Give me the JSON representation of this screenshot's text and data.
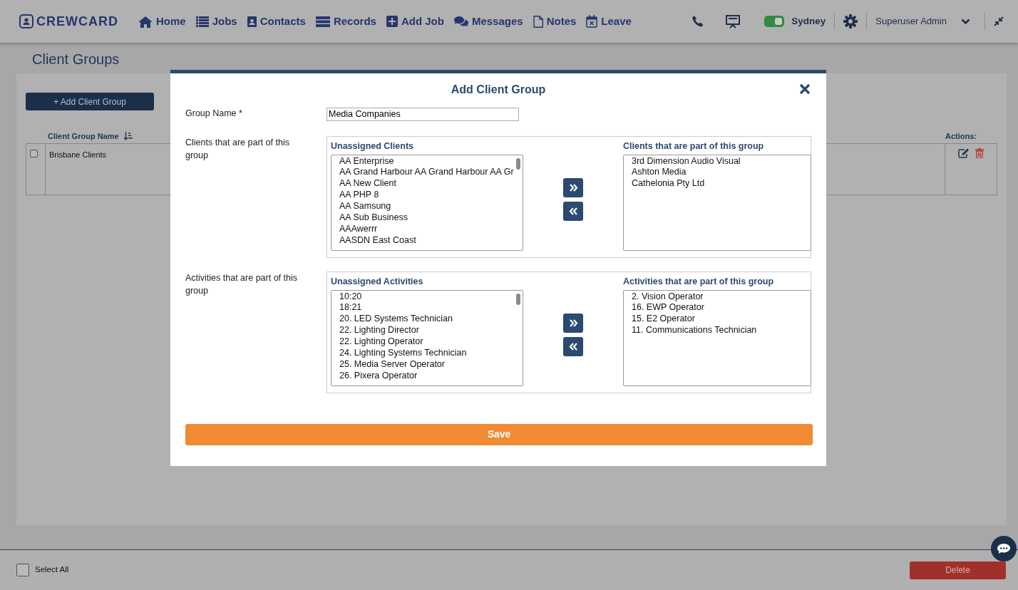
{
  "navbar": {
    "logo": "CREWCARD",
    "items": [
      {
        "label": "Home",
        "kind": "home"
      },
      {
        "label": "Jobs",
        "kind": "list"
      },
      {
        "label": "Contacts",
        "kind": "contacts"
      },
      {
        "label": "Records",
        "kind": "records"
      },
      {
        "label": "Add Job",
        "kind": "add"
      },
      {
        "label": "Messages",
        "kind": "messages"
      },
      {
        "label": "Notes",
        "kind": "notes"
      },
      {
        "label": "Leave",
        "kind": "leave"
      }
    ],
    "location": {
      "label": "Sydney",
      "on": true
    },
    "user": "Superuser Admin"
  },
  "page": {
    "title": "Client Groups",
    "add_button": "+ Add Client Group",
    "columns": [
      "Client Group Name",
      "Actions:"
    ],
    "rows": [
      {
        "name": "Brisbane Clients",
        "checked": false
      }
    ]
  },
  "footer": {
    "select_all": {
      "label": "Select All",
      "checked": false
    },
    "delete_button": "Delete"
  },
  "modal": {
    "title": "Add Client Group",
    "group_name": {
      "label": "Group Name *",
      "value": "Media Companies"
    },
    "sections": [
      {
        "label": "Clients that are part of this group",
        "left_title": "Unassigned Clients",
        "right_title": "Clients that are part of this group",
        "left_items": [
          "AA Enterprise",
          "AA Grand Harbour AA Grand Harbour AA Gr",
          "AA New Client",
          "AA PHP 8",
          "AA Samsung",
          "AA Sub Business",
          "AAAwerrr",
          "AASDN East Coast"
        ],
        "right_items": [
          "3rd Dimension Audio Visual",
          "Ashton Media",
          "Cathelonia Pty Ltd"
        ]
      },
      {
        "label": "Activities that are part of this group",
        "left_title": "Unassigned Activities",
        "right_title": "Activities that are part of this group",
        "left_items": [
          "10:20",
          "18:21",
          "20. LED Systems Technician",
          "22. Lighting Director",
          "22. Lighting Operator",
          "24. Lighting Systems Technician",
          "25. Media Server Operator",
          "26. Pixera Operator"
        ],
        "right_items": [
          "2. Vision Operator",
          "16. EWP Operator",
          "15. E2 Operator",
          "11. Communications Technician"
        ]
      }
    ],
    "save_button": "Save"
  }
}
